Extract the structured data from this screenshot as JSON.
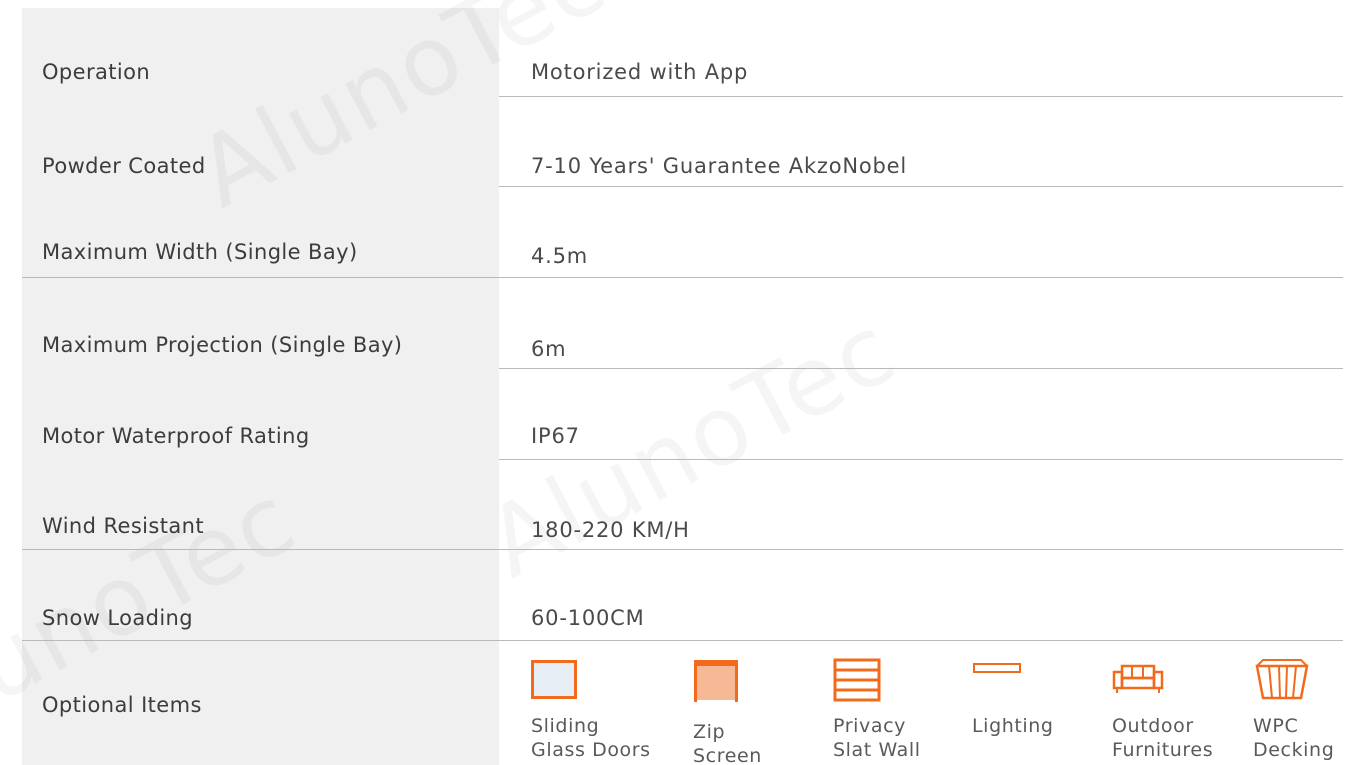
{
  "watermark": "AlunoTec",
  "specs": [
    {
      "label": "Operation",
      "value": "Motorized with App"
    },
    {
      "label": "Powder Coated",
      "value": "7-10 Years' Guarantee AkzoNobel"
    },
    {
      "label": "Maximum Width (Single Bay)",
      "value": "4.5m"
    },
    {
      "label": "Maximum Projection (Single Bay)",
      "value": "6m"
    },
    {
      "label": "Motor Waterproof Rating",
      "value": "IP67"
    },
    {
      "label": "Wind Resistant",
      "value": "180-220 KM/H"
    },
    {
      "label": "Snow Loading",
      "value": "60-100CM"
    }
  ],
  "optional": {
    "label": "Optional Items",
    "items": [
      {
        "icon": "sliding-door-icon",
        "line1": "Sliding",
        "line2": "Glass Doors"
      },
      {
        "icon": "zip-screen-icon",
        "line1": "Zip",
        "line2": "Screen"
      },
      {
        "icon": "slat-wall-icon",
        "line1": "Privacy",
        "line2": "Slat Wall"
      },
      {
        "icon": "lighting-icon",
        "line1": "Lighting",
        "line2": ""
      },
      {
        "icon": "sofa-icon",
        "line1": "Outdoor",
        "line2": "Furnitures"
      },
      {
        "icon": "decking-icon",
        "line1": "WPC",
        "line2": "Decking"
      }
    ]
  },
  "colors": {
    "accent": "#f26b1d",
    "label_bg": "#f0f0f0",
    "divider": "#b9b9b9"
  }
}
